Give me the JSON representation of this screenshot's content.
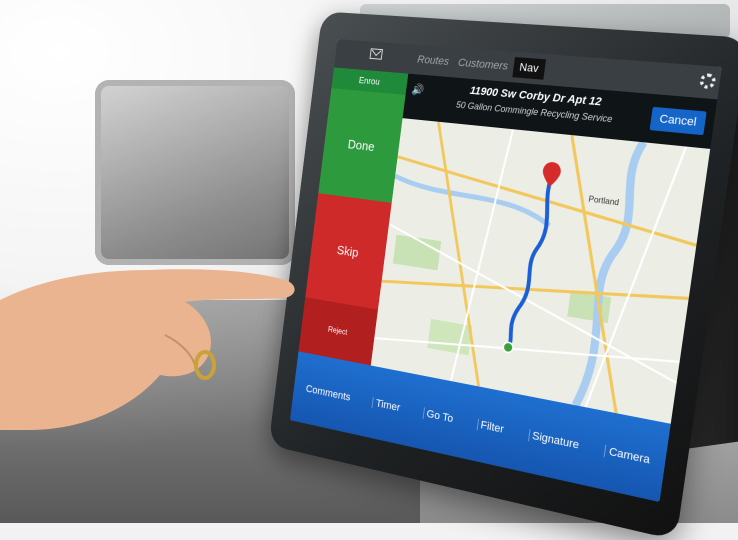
{
  "topbar": {
    "tabs": [
      {
        "label": "Routes",
        "active": false
      },
      {
        "label": "Customers",
        "active": false
      },
      {
        "label": "Nav",
        "active": true
      }
    ],
    "icons": [
      "mail-icon",
      "gear-icon"
    ]
  },
  "actions": {
    "enroute_label": "Enrou",
    "done_label": "Done",
    "skip_label": "Skip",
    "reject_label": "Reject"
  },
  "stop": {
    "address": "11900 Sw Corby Dr Apt 12",
    "service": "50 Gallon Commingle Recycling Service",
    "cancel_label": "Cancel"
  },
  "map": {
    "city_label": "Portland"
  },
  "toolbar": {
    "items": [
      "Comments",
      "Timer",
      "Go To",
      "Filter",
      "Signature",
      "Camera"
    ]
  },
  "colors": {
    "done": "#2e9a3e",
    "skip": "#cf2a2a",
    "toolbar": "#1f6fd0",
    "cancel": "#1565c8",
    "route": "#1a5fd6",
    "destination_pin": "#d62b2b"
  }
}
